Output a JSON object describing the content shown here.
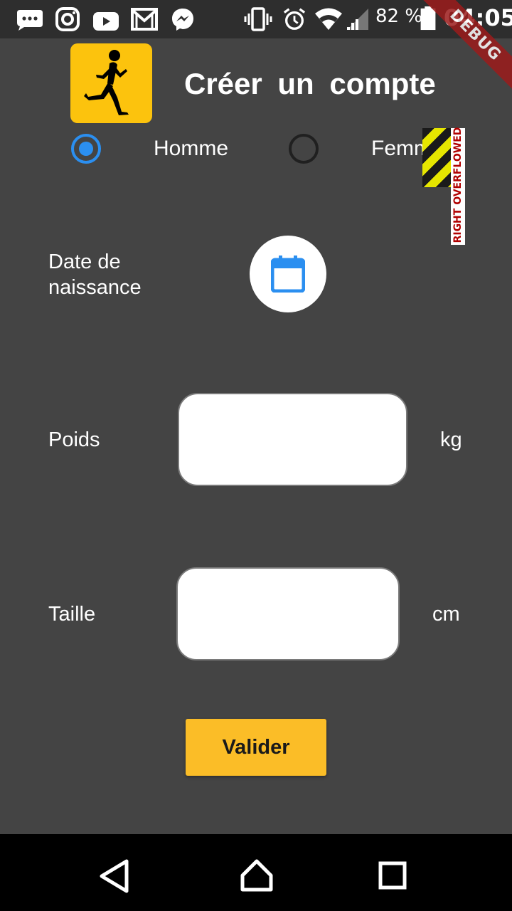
{
  "status_bar": {
    "battery_percent": "82 %",
    "time": "04:05",
    "icons": [
      "chat-bubble-icon",
      "instagram-icon",
      "youtube-icon",
      "gmail-icon",
      "messenger-icon",
      "vibrate-icon",
      "alarm-icon",
      "wifi-icon",
      "signal-icon",
      "battery-icon"
    ]
  },
  "debug_banner": "DEBUG",
  "header": {
    "logo_icon": "runner-icon",
    "title": "Créer  un  compte"
  },
  "gender": {
    "options": [
      "Homme",
      "Femme"
    ],
    "selected": "Homme"
  },
  "overflow_indicator": "RIGHT OVERFLOWED",
  "birth_date": {
    "label_line1": "Date de",
    "label_line2": "naissance",
    "icon": "calendar-icon"
  },
  "weight": {
    "label": "Poids",
    "value": "",
    "unit": "kg"
  },
  "height": {
    "label": "Taille",
    "value": "",
    "unit": "cm"
  },
  "submit_label": "Valider",
  "colors": {
    "background": "#444444",
    "accent": "#2b8ff0",
    "button": "#fbbd27",
    "logo": "#fcc30d"
  },
  "nav_bar": [
    "back-icon",
    "home-icon",
    "recents-icon"
  ]
}
